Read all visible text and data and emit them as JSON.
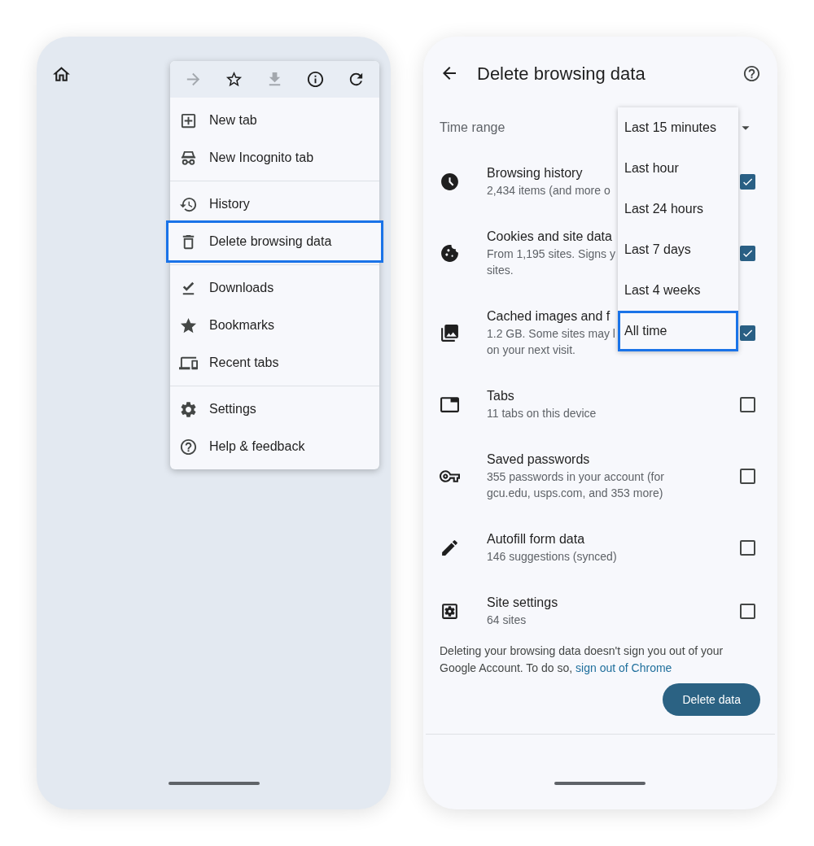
{
  "left_phone": {
    "menu": {
      "toolbar": [
        {
          "kind": "forward",
          "disabled": true
        },
        {
          "kind": "bookmark",
          "disabled": false
        },
        {
          "kind": "download",
          "disabled": true
        },
        {
          "kind": "info",
          "disabled": false
        },
        {
          "kind": "reload",
          "disabled": false
        }
      ],
      "groups": [
        [
          {
            "kind": "new-tab",
            "label": "New tab",
            "selected": false
          },
          {
            "kind": "incognito",
            "label": "New Incognito tab",
            "selected": false
          }
        ],
        [
          {
            "kind": "history",
            "label": "History",
            "selected": false
          },
          {
            "kind": "delete",
            "label": "Delete browsing data",
            "selected": true
          }
        ],
        [
          {
            "kind": "downloads",
            "label": "Downloads",
            "selected": false
          },
          {
            "kind": "bookmarks",
            "label": "Bookmarks",
            "selected": false
          },
          {
            "kind": "recent",
            "label": "Recent tabs",
            "selected": false
          }
        ],
        [
          {
            "kind": "settings",
            "label": "Settings",
            "selected": false
          },
          {
            "kind": "help",
            "label": "Help & feedback",
            "selected": false
          }
        ]
      ]
    }
  },
  "right_phone": {
    "title": "Delete browsing data",
    "time_range": {
      "label": "Time range",
      "expanded": true,
      "options": [
        {
          "label": "Last 15 minutes",
          "selected": false
        },
        {
          "label": "Last hour",
          "selected": false
        },
        {
          "label": "Last 24 hours",
          "selected": false
        },
        {
          "label": "Last 7 days",
          "selected": false
        },
        {
          "label": "Last 4 weeks",
          "selected": false
        },
        {
          "label": "All time",
          "selected": true
        }
      ]
    },
    "data_types": [
      {
        "kind": "history",
        "title": "Browsing history",
        "detail": "2,434 items (and more o",
        "checked": true
      },
      {
        "kind": "cookies",
        "title": "Cookies and site data",
        "detail": "From 1,195 sites. Signs y\nsites.",
        "checked": true
      },
      {
        "kind": "cache",
        "title": "Cached images and f",
        "detail": "1.2 GB. Some sites may l\non your next visit.",
        "checked": true
      },
      {
        "kind": "tabs",
        "title": "Tabs",
        "detail": "11 tabs on this device",
        "checked": false
      },
      {
        "kind": "passwords",
        "title": "Saved passwords",
        "detail": "355 passwords in your account (for\ngcu.edu, usps.com, and 353 more)",
        "checked": false
      },
      {
        "kind": "autofill",
        "title": "Autofill form data",
        "detail": "146 suggestions (synced)",
        "checked": false
      },
      {
        "kind": "site-settings",
        "title": "Site settings",
        "detail": "64 sites",
        "checked": false
      }
    ],
    "footer": {
      "text": "Deleting your browsing data doesn't sign you out of your Google Account. To do so,",
      "link": "sign out of Chrome"
    },
    "delete_button": "Delete data"
  }
}
